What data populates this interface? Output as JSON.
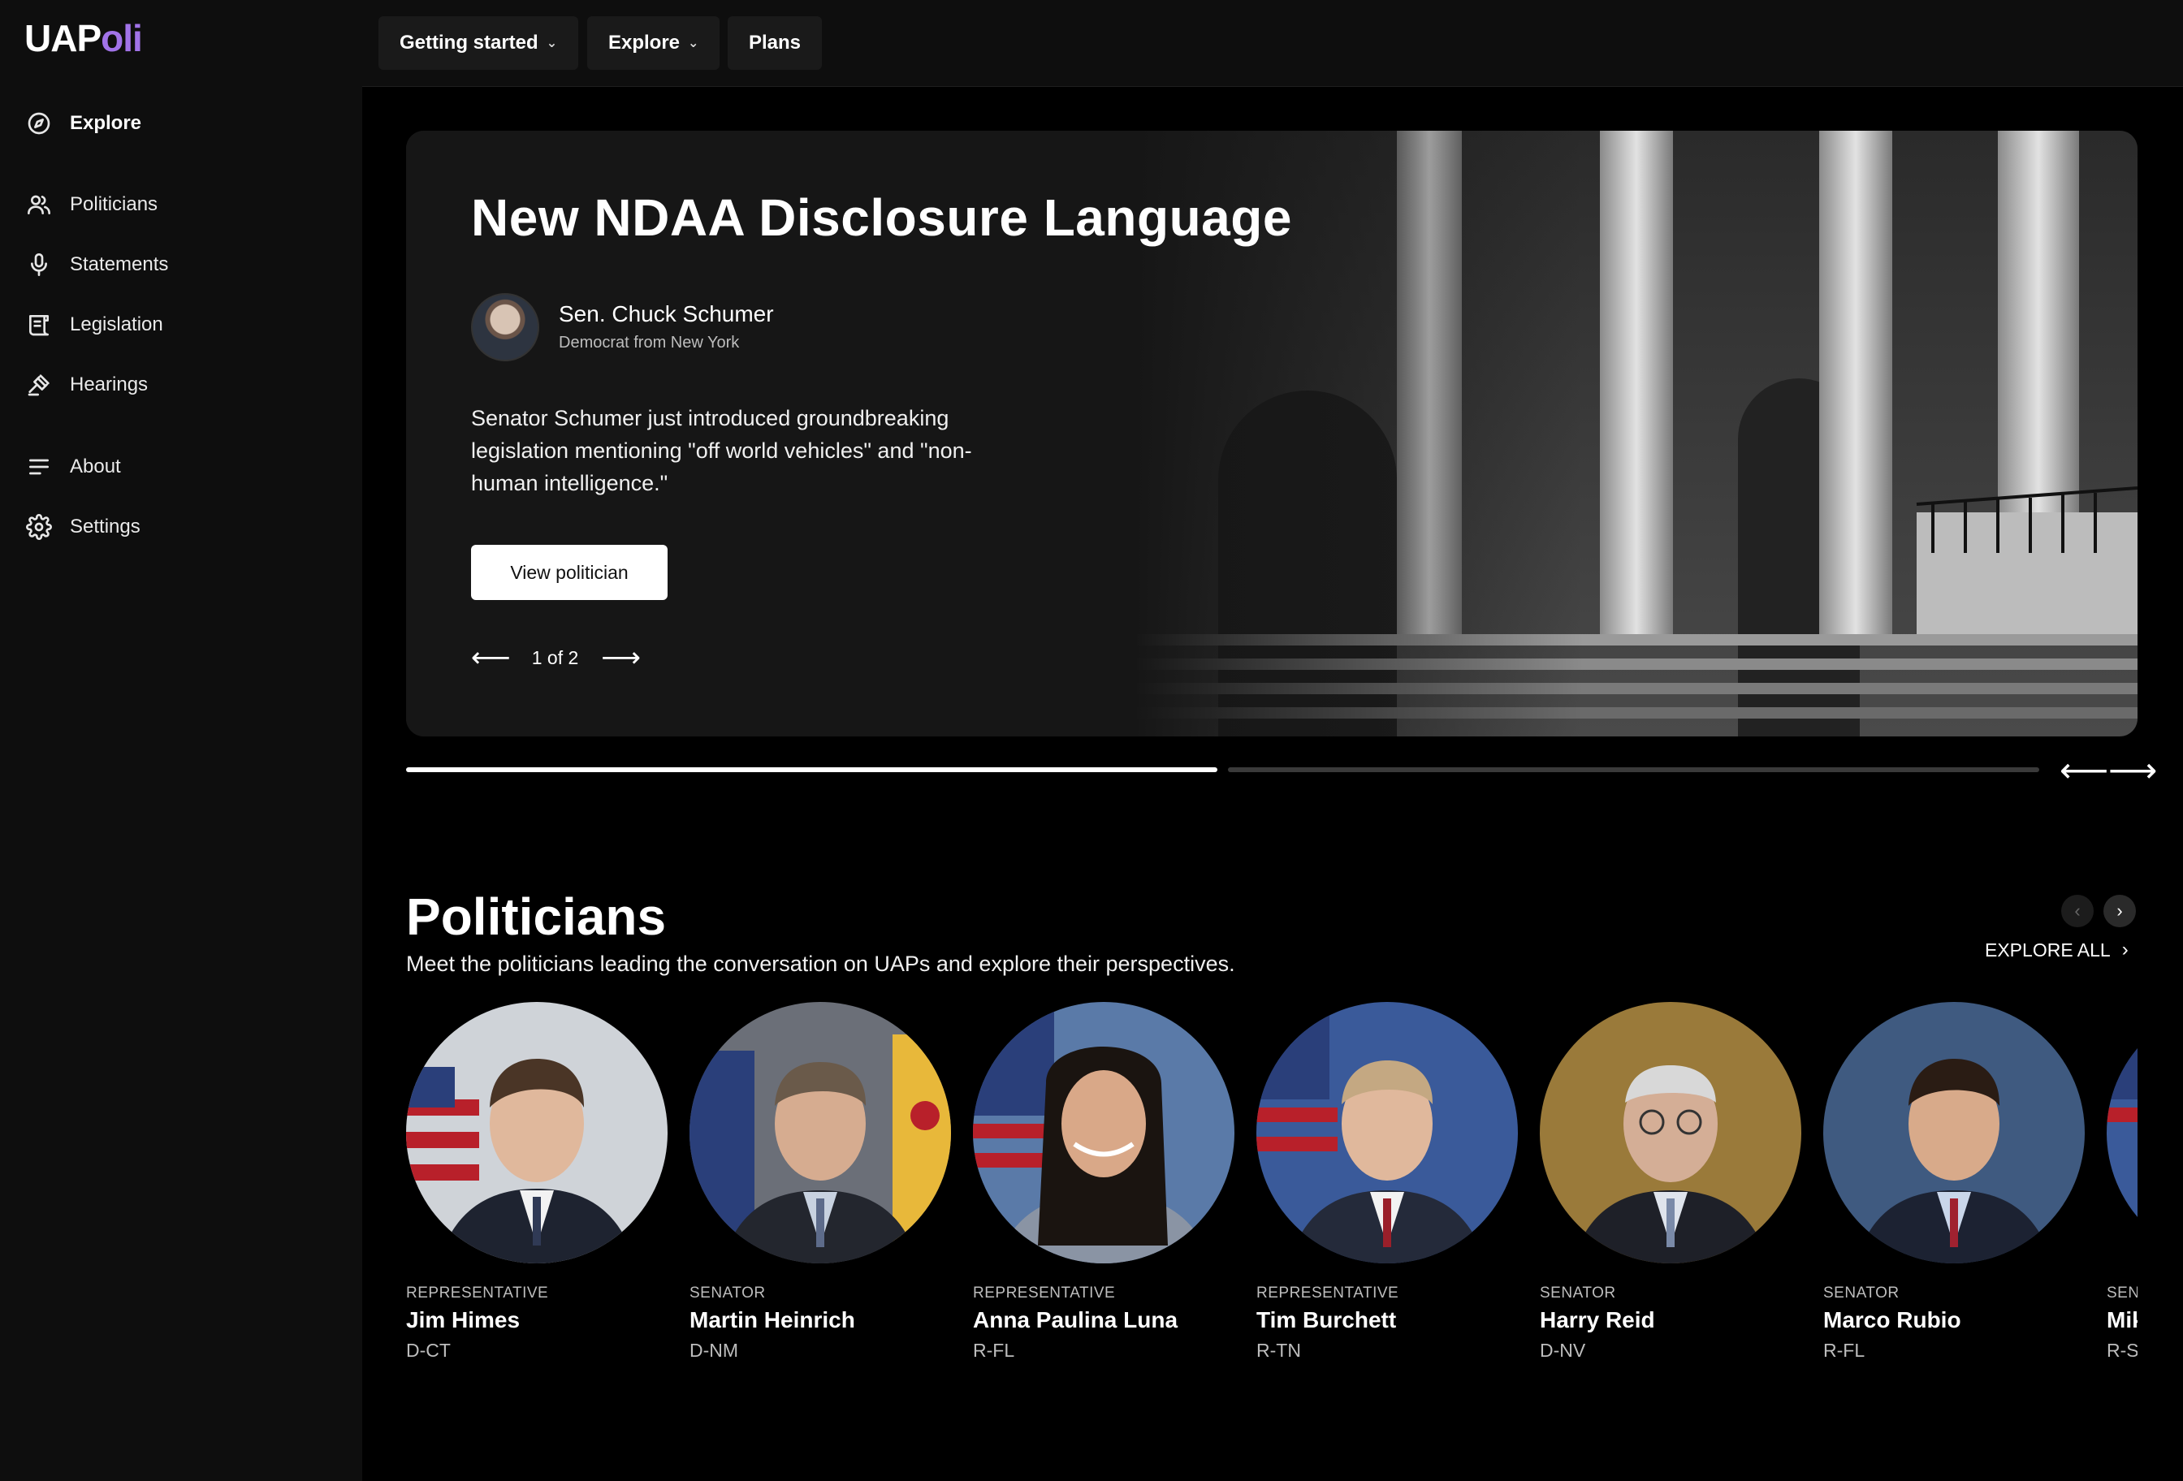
{
  "app": {
    "logo_main": "UAP",
    "logo_accent": "oli"
  },
  "sidebar": {
    "items": [
      {
        "label": "Explore",
        "icon": "compass-icon"
      },
      {
        "label": "Politicians",
        "icon": "people-icon"
      },
      {
        "label": "Statements",
        "icon": "microphone-icon"
      },
      {
        "label": "Legislation",
        "icon": "scroll-icon"
      },
      {
        "label": "Hearings",
        "icon": "gavel-icon"
      },
      {
        "label": "About",
        "icon": "lines-icon"
      },
      {
        "label": "Settings",
        "icon": "gear-icon"
      }
    ]
  },
  "topnav": {
    "items": [
      {
        "label": "Getting started",
        "has_dropdown": true
      },
      {
        "label": "Explore",
        "has_dropdown": true
      },
      {
        "label": "Plans",
        "has_dropdown": false
      }
    ]
  },
  "hero": {
    "title": "New NDAA Disclosure Language",
    "person_name": "Sen. Chuck Schumer",
    "person_sub": "Democrat from New York",
    "description": "Senator Schumer just introduced groundbreaking legislation mentioning \"off world vehicles\" and \"non-human intelligence.\"",
    "button_label": "View politician",
    "pager_text": "1 of 2",
    "prev_arrow": "⟵",
    "next_arrow": "⟶",
    "progress": [
      1.0,
      0.0
    ]
  },
  "politicians": {
    "title": "Politicians",
    "subtitle": "Meet the politicians leading the conversation on UAPs and explore their perspectives.",
    "explore_all": "EXPLORE ALL",
    "cards": [
      {
        "role": "REPRESENTATIVE",
        "name": "Jim Himes",
        "party": "D-CT"
      },
      {
        "role": "SENATOR",
        "name": "Martin Heinrich",
        "party": "D-NM"
      },
      {
        "role": "REPRESENTATIVE",
        "name": "Anna Paulina Luna",
        "party": "R-FL"
      },
      {
        "role": "REPRESENTATIVE",
        "name": "Tim Burchett",
        "party": "R-TN"
      },
      {
        "role": "SENATOR",
        "name": "Harry Reid",
        "party": "D-NV"
      },
      {
        "role": "SENATOR",
        "name": "Marco Rubio",
        "party": "R-FL"
      },
      {
        "role": "SENATOR",
        "name": "Mike Lee",
        "party": "R-SC"
      }
    ]
  },
  "colors": {
    "accent": "#a173e8",
    "background": "#000000",
    "sidebar": "#0e0e0e"
  }
}
